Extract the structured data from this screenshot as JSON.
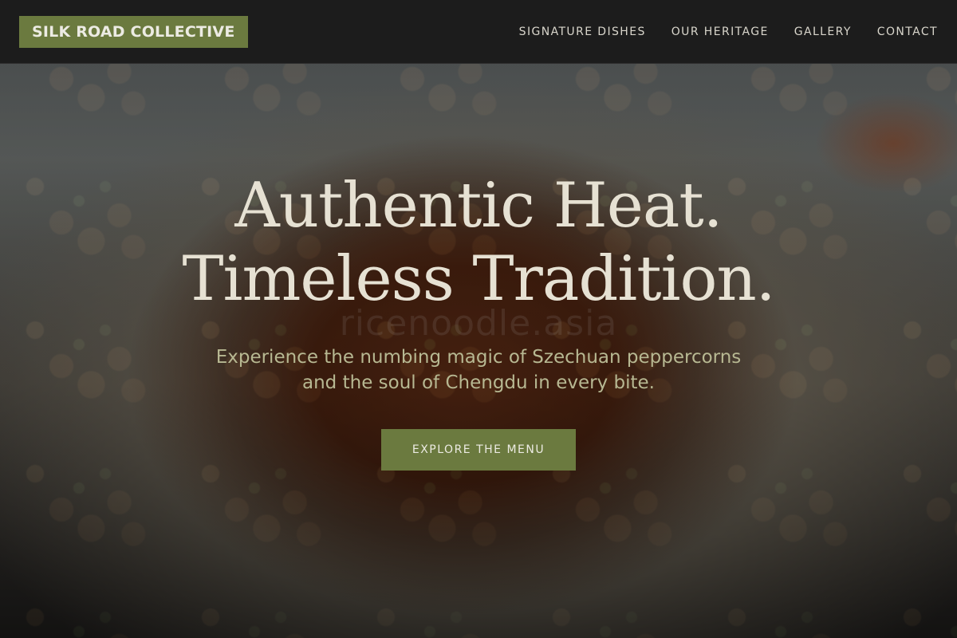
{
  "brand": {
    "name": "SILK ROAD COLLECTIVE",
    "color": "#6b7a3f"
  },
  "nav": {
    "items": [
      {
        "label": "SIGNATURE DISHES"
      },
      {
        "label": "OUR HERITAGE"
      },
      {
        "label": "GALLERY"
      },
      {
        "label": "CONTACT"
      }
    ]
  },
  "hero": {
    "title_line1": "Authentic Heat.",
    "title_line2": "Timeless Tradition.",
    "subtitle": "Experience the numbing magic of Szechuan peppercorns and the soul of Chengdu in every bite.",
    "cta_label": "EXPLORE THE MENU",
    "watermark": "ricenoodle.asia",
    "background_image": "kung-pao-dish-photo"
  },
  "colors": {
    "accent": "#6b7a3f",
    "nav_bg": "#1c1c1c",
    "title_text": "#e6e1d3",
    "subtitle_text": "#b7b892"
  }
}
